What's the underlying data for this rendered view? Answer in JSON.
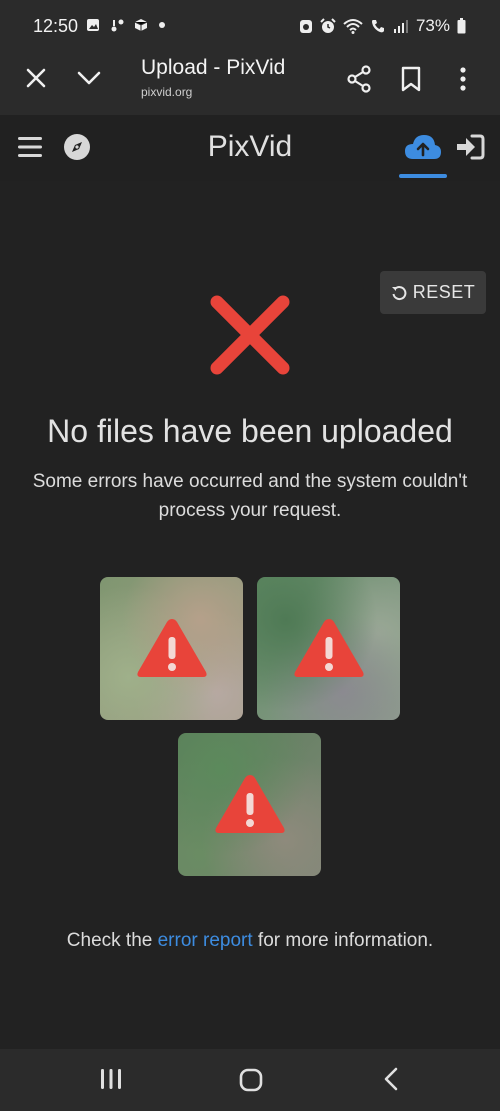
{
  "status_bar": {
    "time": "12:50",
    "battery": "73%",
    "icons_left": [
      "image-icon",
      "activity-icon",
      "package-icon",
      "dot-icon"
    ],
    "icons_right": [
      "alarm-app-icon",
      "alarm-clock-icon",
      "wifi-icon",
      "call-signal-icon",
      "signal-bars-icon",
      "battery-icon"
    ]
  },
  "browser": {
    "title": "Upload - PixVid",
    "url": "pixvid.org"
  },
  "app": {
    "title": "PixVid",
    "accent": "#3d8ce0"
  },
  "main": {
    "reset_label": "RESET",
    "heading": "No files have been uploaded",
    "description": "Some errors have occurred and the system couldn't process your request.",
    "error_color": "#e8443a",
    "footer_before": "Check the ",
    "footer_link": "error report",
    "footer_after": " for more information."
  }
}
